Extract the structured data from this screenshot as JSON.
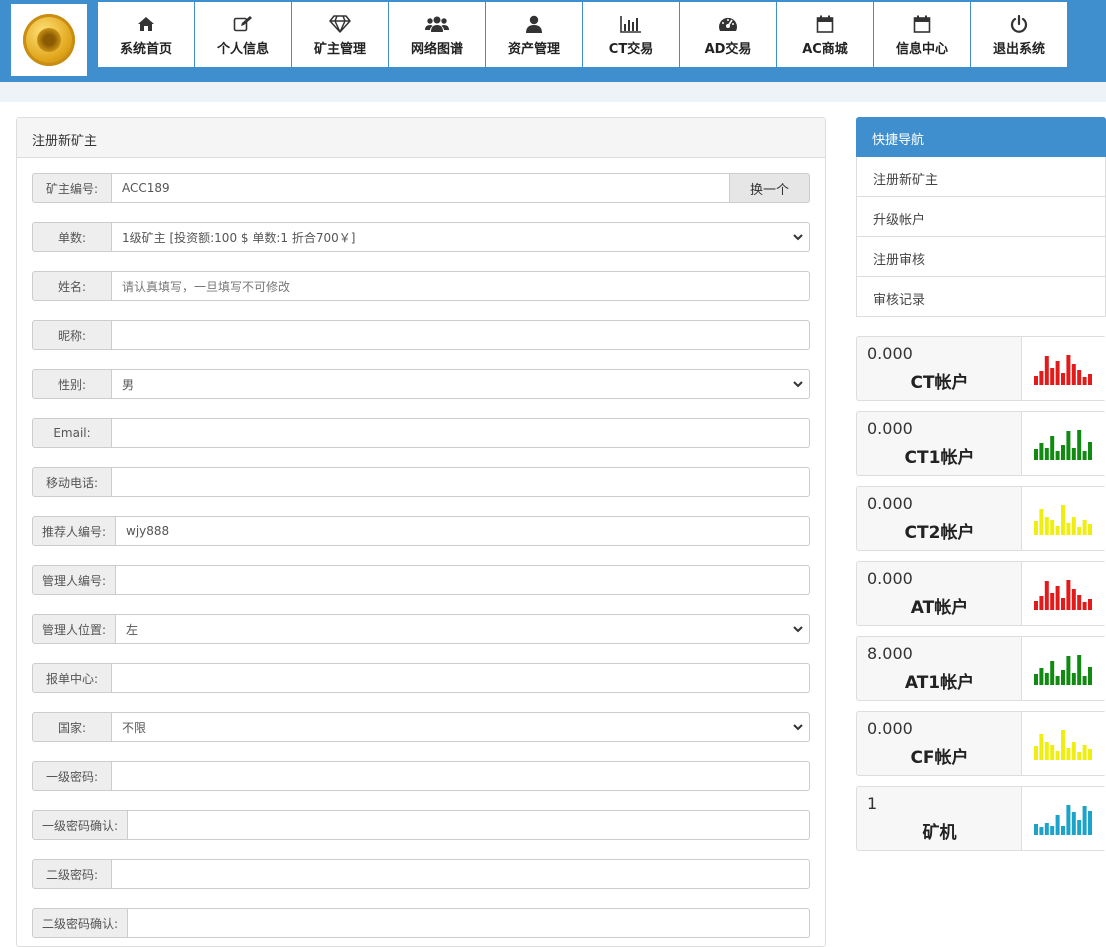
{
  "nav": [
    {
      "label": "系统首页",
      "icon": "home-icon"
    },
    {
      "label": "个人信息",
      "icon": "edit-icon"
    },
    {
      "label": "矿主管理",
      "icon": "diamond-icon"
    },
    {
      "label": "网络图谱",
      "icon": "users-icon"
    },
    {
      "label": "资产管理",
      "icon": "user-icon"
    },
    {
      "label": "CT交易",
      "icon": "bar-chart-icon"
    },
    {
      "label": "AD交易",
      "icon": "dashboard-icon"
    },
    {
      "label": "AC商城",
      "icon": "calendar-icon"
    },
    {
      "label": "信息中心",
      "icon": "calendar-icon"
    },
    {
      "label": "退出系统",
      "icon": "power-icon"
    }
  ],
  "form": {
    "title": "注册新矿主",
    "fields": [
      {
        "label": "矿主编号:",
        "value": "ACC189",
        "type": "text",
        "button": "换一个"
      },
      {
        "label": "单数:",
        "value": "1级矿主 [投资额:100 $  单数:1 折合700￥]",
        "type": "select"
      },
      {
        "label": "姓名:",
        "placeholder": "请认真填写，一旦填写不可修改",
        "type": "text"
      },
      {
        "label": "昵称:",
        "value": "",
        "type": "text"
      },
      {
        "label": "性别:",
        "value": "男",
        "type": "select"
      },
      {
        "label": "Email:",
        "value": "",
        "type": "text"
      },
      {
        "label": "移动电话:",
        "value": "",
        "type": "text"
      },
      {
        "label": "推荐人编号:",
        "value": "wjy888",
        "type": "text"
      },
      {
        "label": "管理人编号:",
        "value": "",
        "type": "text"
      },
      {
        "label": "管理人位置:",
        "value": "左",
        "type": "select"
      },
      {
        "label": "报单中心:",
        "value": "",
        "type": "text"
      },
      {
        "label": "国家:",
        "value": "不限",
        "type": "select"
      },
      {
        "label": "一级密码:",
        "value": "",
        "type": "password"
      },
      {
        "label": "一级密码确认:",
        "value": "",
        "type": "password"
      },
      {
        "label": "二级密码:",
        "value": "",
        "type": "password"
      },
      {
        "label": "二级密码确认:",
        "value": "",
        "type": "password"
      }
    ]
  },
  "quick_nav": {
    "title": "快捷导航",
    "items": [
      "注册新矿主",
      "升级帐户",
      "注册审核",
      "审核记录"
    ]
  },
  "stats": [
    {
      "value": "0.000",
      "name": "CT帐户",
      "color": "#e31a1a",
      "bars": [
        0.3,
        0.45,
        0.95,
        0.55,
        0.8,
        0.4,
        1.0,
        0.7,
        0.5,
        0.25,
        0.35
      ]
    },
    {
      "value": "0.000",
      "name": "CT1帐户",
      "color": "#118a11",
      "bars": [
        0.35,
        0.55,
        0.4,
        0.8,
        0.3,
        0.5,
        0.95,
        0.4,
        1.0,
        0.3,
        0.6
      ]
    },
    {
      "value": "0.000",
      "name": "CT2帐户",
      "color": "#f0ee10",
      "bars": [
        0.45,
        0.85,
        0.6,
        0.5,
        0.3,
        1.0,
        0.4,
        0.6,
        0.25,
        0.5,
        0.35
      ]
    },
    {
      "value": "0.000",
      "name": "AT帐户",
      "color": "#e31a1a",
      "bars": [
        0.3,
        0.45,
        0.95,
        0.55,
        0.8,
        0.4,
        1.0,
        0.7,
        0.5,
        0.25,
        0.35
      ]
    },
    {
      "value": "8.000",
      "name": "AT1帐户",
      "color": "#118a11",
      "bars": [
        0.35,
        0.55,
        0.4,
        0.8,
        0.3,
        0.5,
        0.95,
        0.4,
        1.0,
        0.3,
        0.6
      ]
    },
    {
      "value": "0.000",
      "name": "CF帐户",
      "color": "#f0ee10",
      "bars": [
        0.45,
        0.85,
        0.6,
        0.5,
        0.3,
        1.0,
        0.4,
        0.6,
        0.25,
        0.5,
        0.35
      ]
    },
    {
      "value": "1",
      "name": "矿机",
      "color": "#1ba3c9",
      "bars": [
        0.35,
        0.25,
        0.4,
        0.3,
        0.65,
        0.3,
        1.0,
        0.75,
        0.5,
        0.95,
        0.8
      ]
    }
  ]
}
